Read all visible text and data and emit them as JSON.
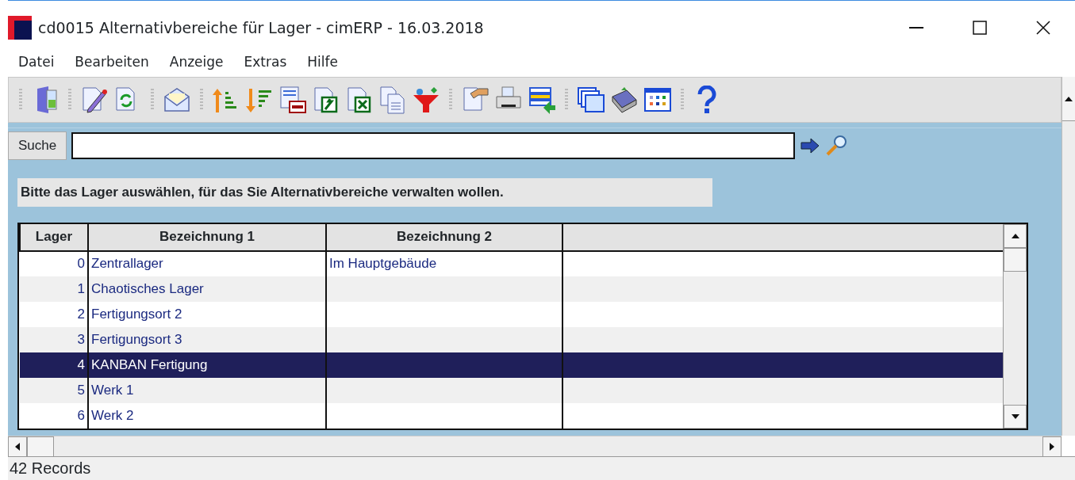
{
  "window": {
    "title": "cd0015 Alternativbereiche für Lager - cimERP - 16.03.2018"
  },
  "menu": [
    "Datei",
    "Bearbeiten",
    "Anzeige",
    "Extras",
    "Hilfe"
  ],
  "search": {
    "label": "Suche"
  },
  "instruction": "Bitte das Lager auswählen, für das Sie Alternativbereiche verwalten wollen.",
  "table": {
    "columns": [
      "Lager",
      "Bezeichnung 1",
      "Bezeichnung 2"
    ],
    "rows": [
      {
        "cells": [
          "0",
          "Zentrallager",
          "Im Hauptgebäude"
        ],
        "selected": false
      },
      {
        "cells": [
          "1",
          "Chaotisches Lager",
          ""
        ],
        "selected": false
      },
      {
        "cells": [
          "2",
          "Fertigungsort 2",
          ""
        ],
        "selected": false
      },
      {
        "cells": [
          "3",
          "Fertigungsort 3",
          ""
        ],
        "selected": false
      },
      {
        "cells": [
          "4",
          "KANBAN Fertigung",
          ""
        ],
        "selected": true
      },
      {
        "cells": [
          "5",
          "Werk 1",
          ""
        ],
        "selected": false
      },
      {
        "cells": [
          "6",
          "Werk 2",
          ""
        ],
        "selected": false
      }
    ]
  },
  "status_bar": "42 Records"
}
